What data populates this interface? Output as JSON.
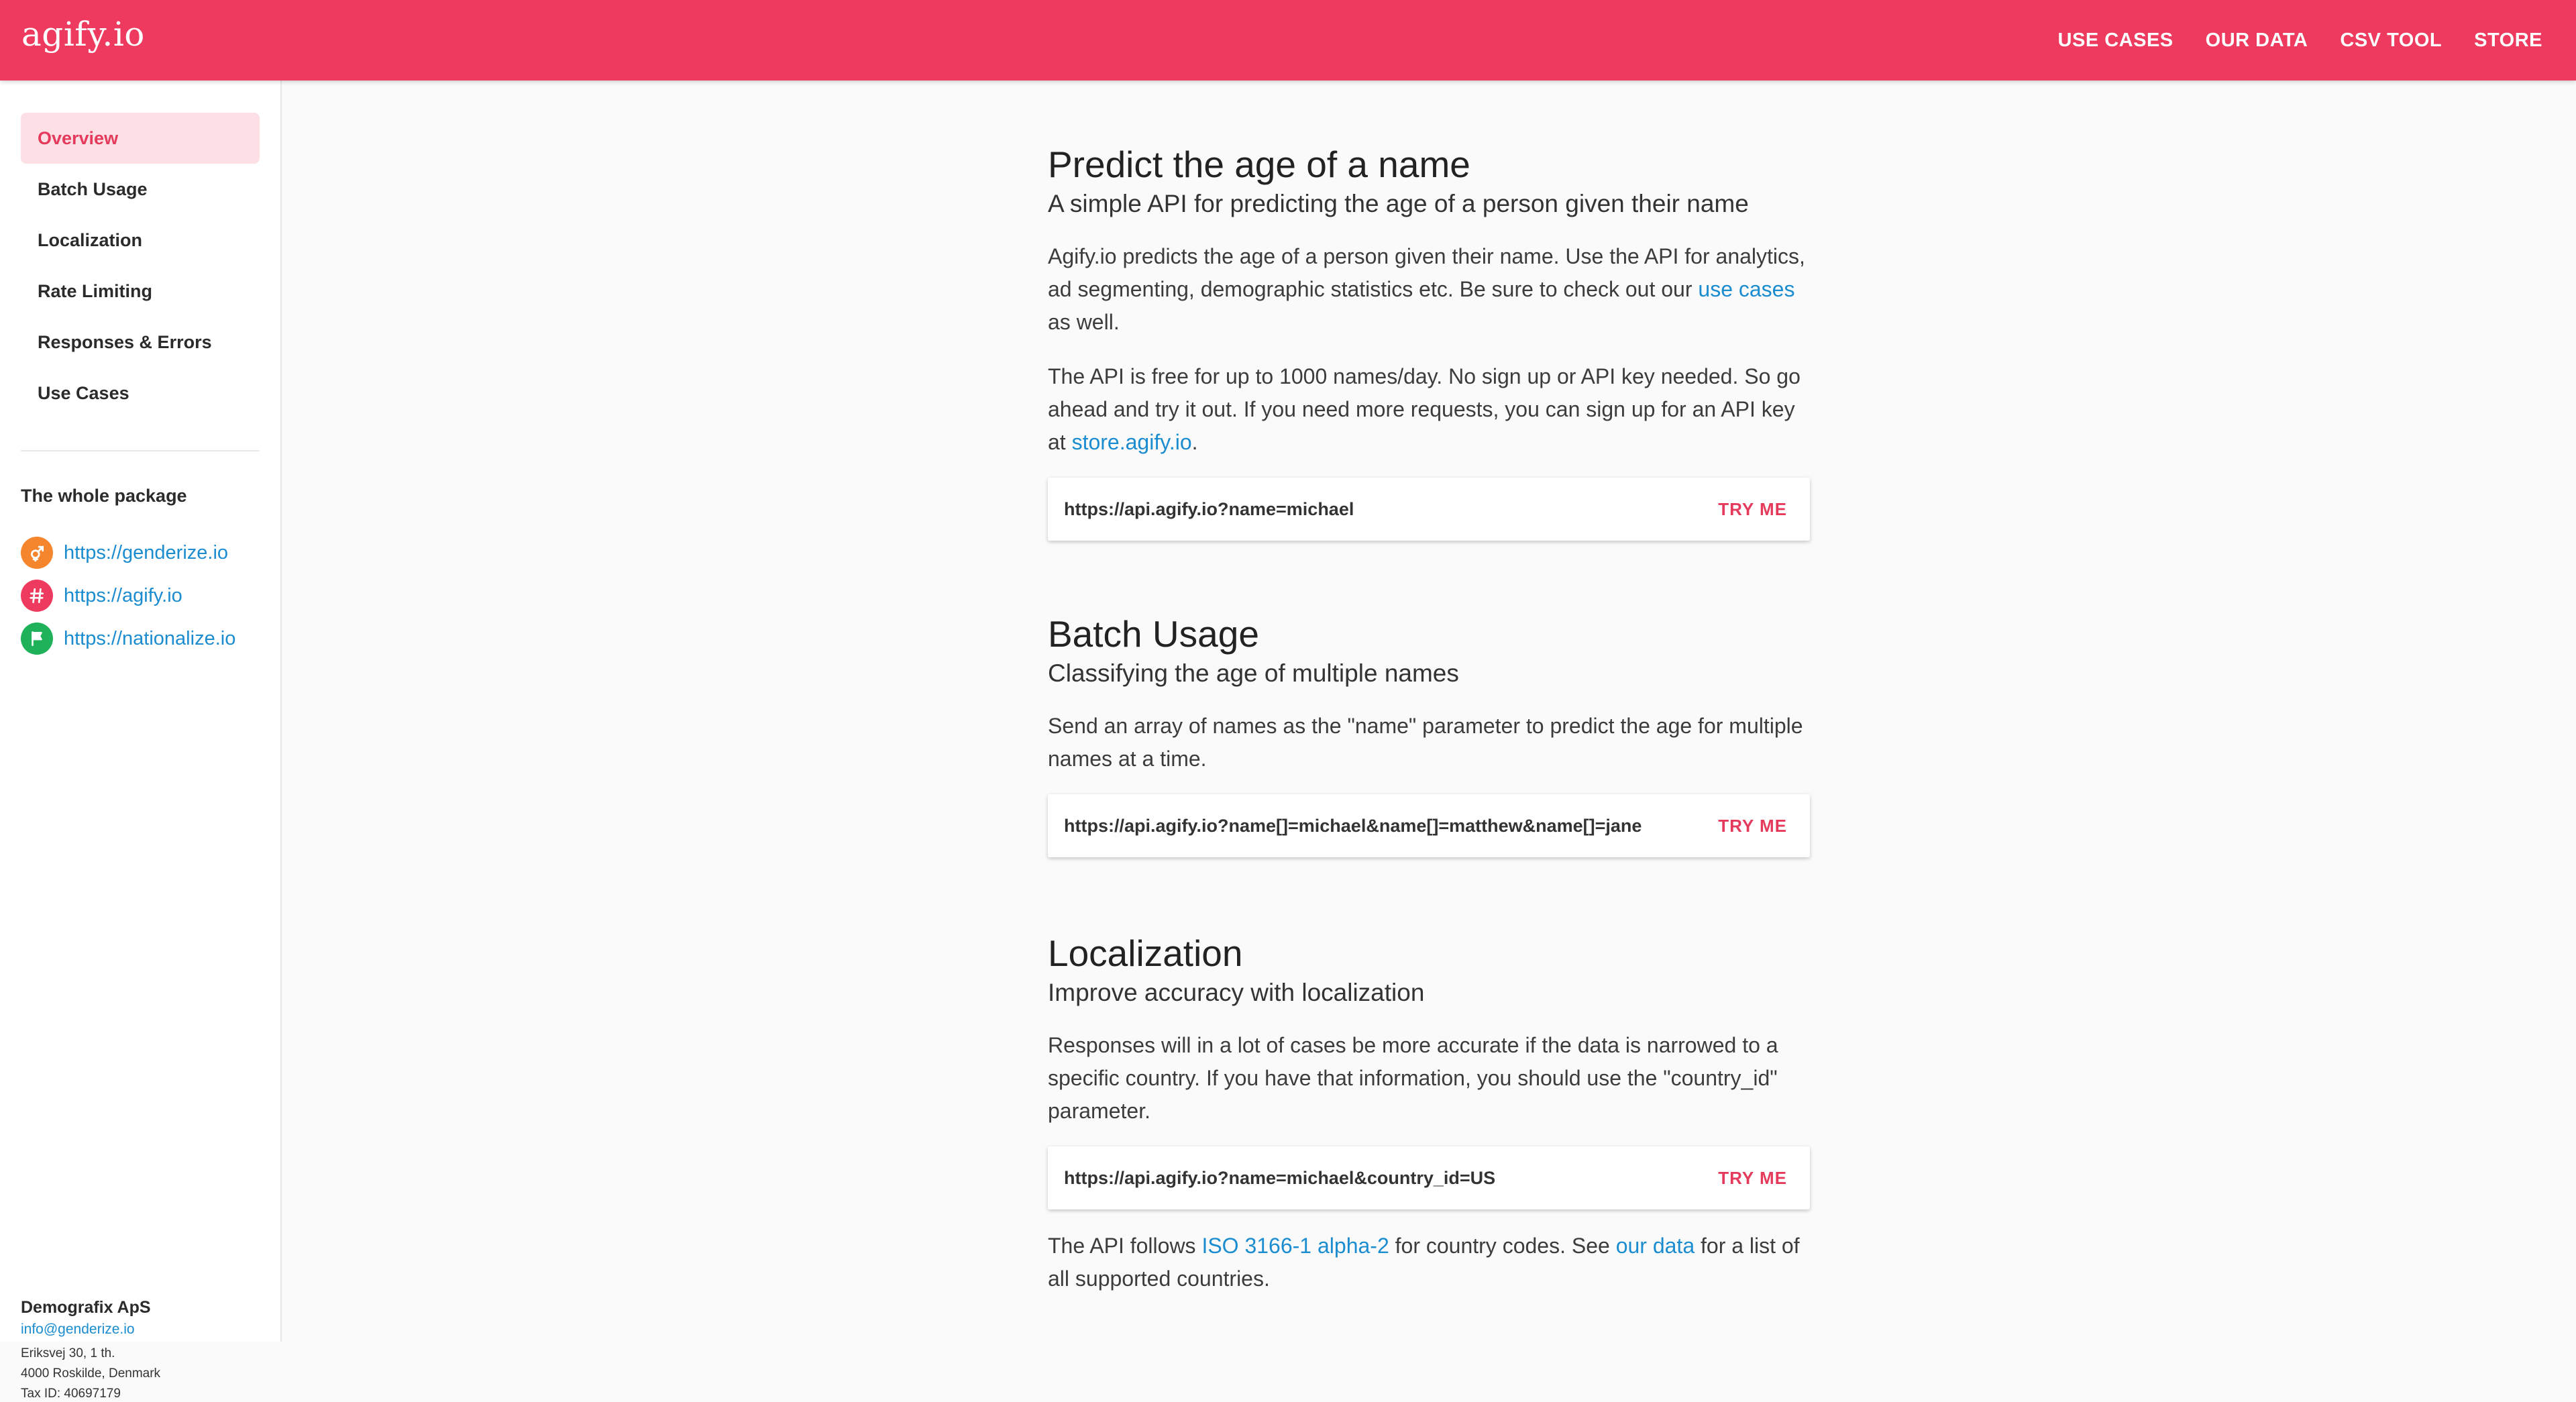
{
  "header": {
    "brand": "agify.io",
    "nav": [
      "USE CASES",
      "OUR DATA",
      "CSV TOOL",
      "STORE"
    ]
  },
  "sidebar": {
    "items": [
      {
        "label": "Overview",
        "active": true
      },
      {
        "label": "Batch Usage",
        "active": false
      },
      {
        "label": "Localization",
        "active": false
      },
      {
        "label": "Rate Limiting",
        "active": false
      },
      {
        "label": "Responses & Errors",
        "active": false
      },
      {
        "label": "Use Cases",
        "active": false
      }
    ],
    "package_title": "The whole package",
    "packages": [
      {
        "url": "https://genderize.io",
        "icon": "gender-icon",
        "color": "#f5862e"
      },
      {
        "url": "https://agify.io",
        "icon": "hash-icon",
        "color": "#ee3a5e"
      },
      {
        "url": "https://nationalize.io",
        "icon": "flag-icon",
        "color": "#1fb25a"
      }
    ],
    "footer": {
      "company": "Demografix ApS",
      "email": "info@genderize.io",
      "address1": "Eriksvej 30, 1 th.",
      "address2": "4000 Roskilde, Denmark",
      "tax": "Tax ID: 40697179"
    }
  },
  "main": {
    "overview": {
      "title": "Predict the age of a name",
      "subtitle": "A simple API for predicting the age of a person given their name",
      "p1_before": "Agify.io predicts the age of a person given their name. Use the API for analytics, ad segmenting, demographic statistics etc. Be sure to check out our ",
      "p1_link": "use cases",
      "p1_after": " as well.",
      "p2_before": "The API is free for up to 1000 names/day. No sign up or API key needed. So go ahead and try it out. If you need more requests, you can sign up for an API key at ",
      "p2_link": "store.agify.io",
      "p2_after": ".",
      "code": "https://api.agify.io?name=michael",
      "try": "TRY ME"
    },
    "batch": {
      "title": "Batch Usage",
      "subtitle": "Classifying the age of multiple names",
      "p1": "Send an array of names as the \"name\" parameter to predict the age for multiple names at a time.",
      "code": "https://api.agify.io?name[]=michael&name[]=matthew&name[]=jane",
      "try": "TRY ME"
    },
    "localization": {
      "title": "Localization",
      "subtitle": "Improve accuracy with localization",
      "p1": "Responses will in a lot of cases be more accurate if the data is narrowed to a specific country. If you have that information, you should use the \"country_id\" parameter.",
      "code": "https://api.agify.io?name=michael&country_id=US",
      "try": "TRY ME",
      "p2_before": "The API follows ",
      "p2_link1": "ISO 3166-1 alpha-2",
      "p2_mid": " for country codes. See ",
      "p2_link2": "our data",
      "p2_after": " for a list of all supported countries."
    }
  }
}
